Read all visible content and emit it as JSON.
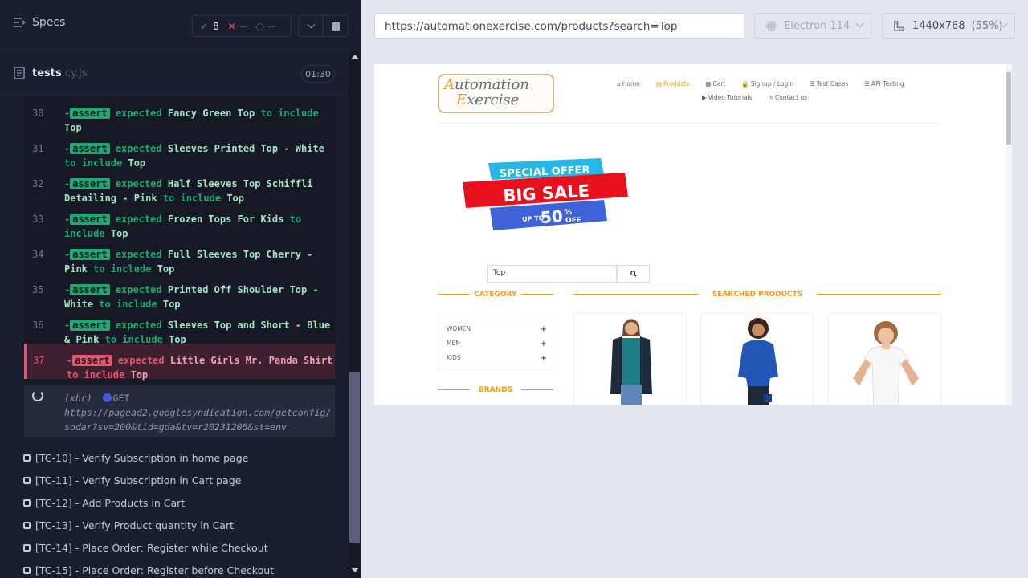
{
  "sidebar": {
    "title": "Specs",
    "stats": {
      "passed": "8",
      "failed": "--",
      "pending": "--"
    },
    "file": {
      "name": "tests",
      "ext": ".cy.js"
    },
    "timer": "01:30"
  },
  "commands": [
    {
      "num": "30",
      "badge": "assert",
      "pre": "expected",
      "subject": "Fancy Green Top",
      "mid": "to include",
      "value": "Top",
      "status": "pass"
    },
    {
      "num": "31",
      "badge": "assert",
      "pre": "expected",
      "subject": "Sleeves Printed Top - White",
      "mid": "to include",
      "value": "Top",
      "status": "pass"
    },
    {
      "num": "32",
      "badge": "assert",
      "pre": "expected",
      "subject": "Half Sleeves Top Schiffli Detailing - Pink",
      "mid": "to include",
      "value": "Top",
      "status": "pass"
    },
    {
      "num": "33",
      "badge": "assert",
      "pre": "expected",
      "subject": "Frozen Tops For Kids",
      "mid": "to include",
      "value": "Top",
      "status": "pass"
    },
    {
      "num": "34",
      "badge": "assert",
      "pre": "expected",
      "subject": "Full Sleeves Top Cherry - Pink",
      "mid": "to include",
      "value": "Top",
      "status": "pass"
    },
    {
      "num": "35",
      "badge": "assert",
      "pre": "expected",
      "subject": "Printed Off Shoulder Top - White",
      "mid": "to include",
      "value": "Top",
      "status": "pass"
    },
    {
      "num": "36",
      "badge": "assert",
      "pre": "expected",
      "subject": "Sleeves Top and Short - Blue & Pink",
      "mid": "to include",
      "value": "Top",
      "status": "pass"
    },
    {
      "num": "37",
      "badge": "assert",
      "pre": "expected",
      "subject": "Little Girls Mr. Panda Shirt",
      "mid": "to include",
      "value": "Top",
      "status": "fail"
    }
  ],
  "xhr": {
    "type": "(xhr)",
    "method": "GET",
    "url": "https://pagead2.googlesyndication.com/getconfig/sodar?sv=200&tid=gda&tv=r20231206&st=env"
  },
  "tests": [
    "[TC-10] - Verify Subscription in home page",
    "[TC-11] - Verify Subscription in Cart page",
    "[TC-12] - Add Products in Cart",
    "[TC-13] - Verify Product quantity in Cart",
    "[TC-14] - Place Order: Register while Checkout",
    "[TC-15] - Place Order: Register before Checkout"
  ],
  "toolbar": {
    "url": "https://automationexercise.com/products?search=Top",
    "browser": "Electron 114",
    "viewport": "1440x768",
    "scale": "(55%)"
  },
  "aut": {
    "logo": [
      "Automation",
      "Exercise"
    ],
    "nav": [
      "Home",
      "Products",
      "Cart",
      "Signup / Login",
      "Test Cases",
      "API Testing",
      "Video Tutorials",
      "Contact us"
    ],
    "sale": {
      "line1": "SPECIAL OFFER",
      "line2": "BIG SALE",
      "line3": "UP TO",
      "line4": "50",
      "line5": "%",
      "line6": "OFF"
    },
    "search_value": "Top",
    "category_heading": "CATEGORY",
    "categories": [
      "WOMEN",
      "MEN",
      "KIDS"
    ],
    "brands_heading": "BRANDS",
    "products_heading": "SEARCHED PRODUCTS"
  }
}
